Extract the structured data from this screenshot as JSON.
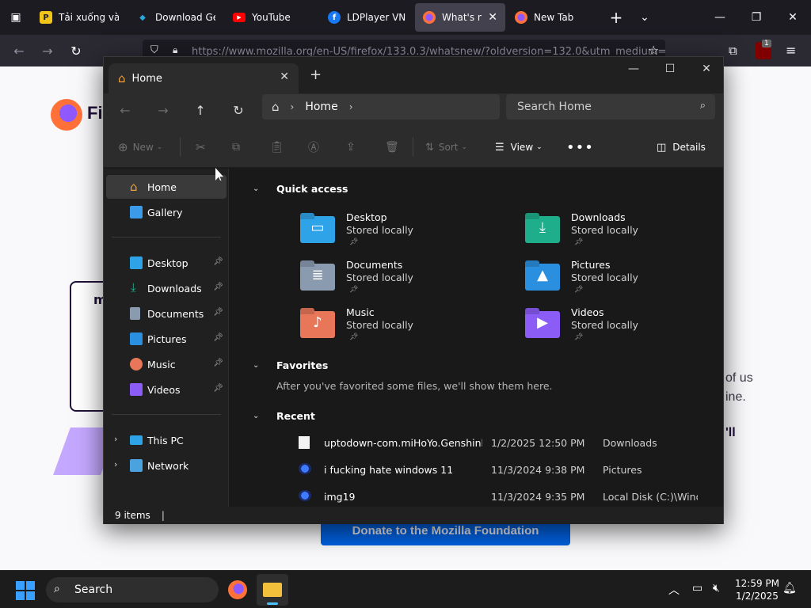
{
  "browser": {
    "tabs": [
      {
        "title": "Tải xuống và s",
        "fav_color": "#f0c419",
        "active": false
      },
      {
        "title": "Download Ge",
        "fav_color": "#2aa7d9",
        "active": false
      },
      {
        "title": "YouTube",
        "fav_color": "#ff0000",
        "active": false
      },
      {
        "title": "LDPlayer VN |",
        "fav_color": "#1877f2",
        "active": false
      },
      {
        "title": "What's new",
        "fav_color": "#ff7139",
        "active": true
      },
      {
        "title": "New Tab",
        "fav_color": "#ff7139",
        "active": false
      }
    ],
    "url": "https://www.mozilla.org/en-US/firefox/133.0.3/whatsnew/?oldversion=132.0&utm_medium=",
    "extension_badge": "1"
  },
  "webpage": {
    "logo_text": "Fi",
    "side_text_1": "of us",
    "side_text_2": "ine.",
    "side_text_3": "'ll",
    "donate_label": "Donate to the Mozilla Foundation",
    "box_text": "m"
  },
  "explorer": {
    "tab_title": "Home",
    "address": {
      "crumb": "Home"
    },
    "search_placeholder": "Search Home",
    "commands": {
      "new": "New",
      "sort": "Sort",
      "view": "View",
      "details": "Details"
    },
    "nav": {
      "home": "Home",
      "gallery": "Gallery",
      "desktop": "Desktop",
      "downloads": "Downloads",
      "documents": "Documents",
      "pictures": "Pictures",
      "music": "Music",
      "videos": "Videos",
      "this_pc": "This PC",
      "network": "Network"
    },
    "sections": {
      "quick_access": "Quick access",
      "favorites": "Favorites",
      "favorites_empty": "After you've favorited some files, we'll show them here.",
      "recent": "Recent"
    },
    "quick_access": [
      {
        "name": "Desktop",
        "sub": "Stored locally",
        "color": "#2fa3e8"
      },
      {
        "name": "Downloads",
        "sub": "Stored locally",
        "color": "#1fae8c"
      },
      {
        "name": "Documents",
        "sub": "Stored locally",
        "color": "#8a9bb0"
      },
      {
        "name": "Pictures",
        "sub": "Stored locally",
        "color": "#2b8fe0"
      },
      {
        "name": "Music",
        "sub": "Stored locally",
        "color": "#e8775a"
      },
      {
        "name": "Videos",
        "sub": "Stored locally",
        "color": "#8b5cf6"
      }
    ],
    "recent": [
      {
        "name": "uptodown-com.miHoYo.Genshinl...",
        "date": "1/2/2025 12:50 PM",
        "location": "Downloads"
      },
      {
        "name": "i fucking hate windows 11",
        "date": "11/3/2024 9:38 PM",
        "location": "Pictures"
      },
      {
        "name": "img19",
        "date": "11/3/2024 9:35 PM",
        "location": "Local Disk (C:)\\Wind..."
      }
    ],
    "status": "9 items"
  },
  "taskbar": {
    "search": "Search",
    "time": "12:59 PM",
    "date": "1/2/2025"
  }
}
